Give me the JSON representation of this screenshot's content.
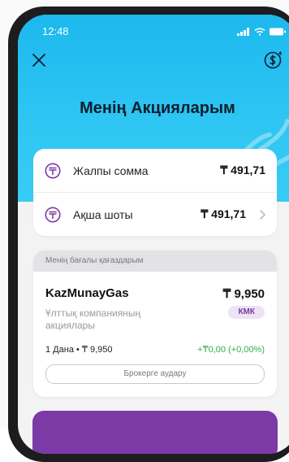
{
  "status_bar": {
    "time": "12:48"
  },
  "header": {
    "title": "Менің Акцияларым"
  },
  "summary": {
    "total": {
      "label": "Жалпы сомма",
      "amount": "₸ 491,71"
    },
    "cash": {
      "label": "Ақша шоты",
      "amount": "₸ 491,71"
    }
  },
  "portfolio": {
    "section_title": "Менің бағалы қағаздарым",
    "stock": {
      "name": "KazMunayGas",
      "price": "₸ 9,950",
      "description": "Ұлттық компанияның акциялары",
      "badge": "КМК",
      "quantity": "1 Дана • ₸ 9,950",
      "change": "+₸0,00  (+0,00%)",
      "transfer_label": "Брокерге аудару"
    }
  },
  "colors": {
    "header_blue": "#1cb8ee",
    "accent_purple": "#7b3aa6",
    "positive_green": "#2fb14a"
  },
  "icons": [
    "close-icon",
    "currency-exchange-icon",
    "tenge-icon",
    "chevron-right-icon",
    "signal-icon",
    "wifi-icon",
    "battery-icon"
  ]
}
